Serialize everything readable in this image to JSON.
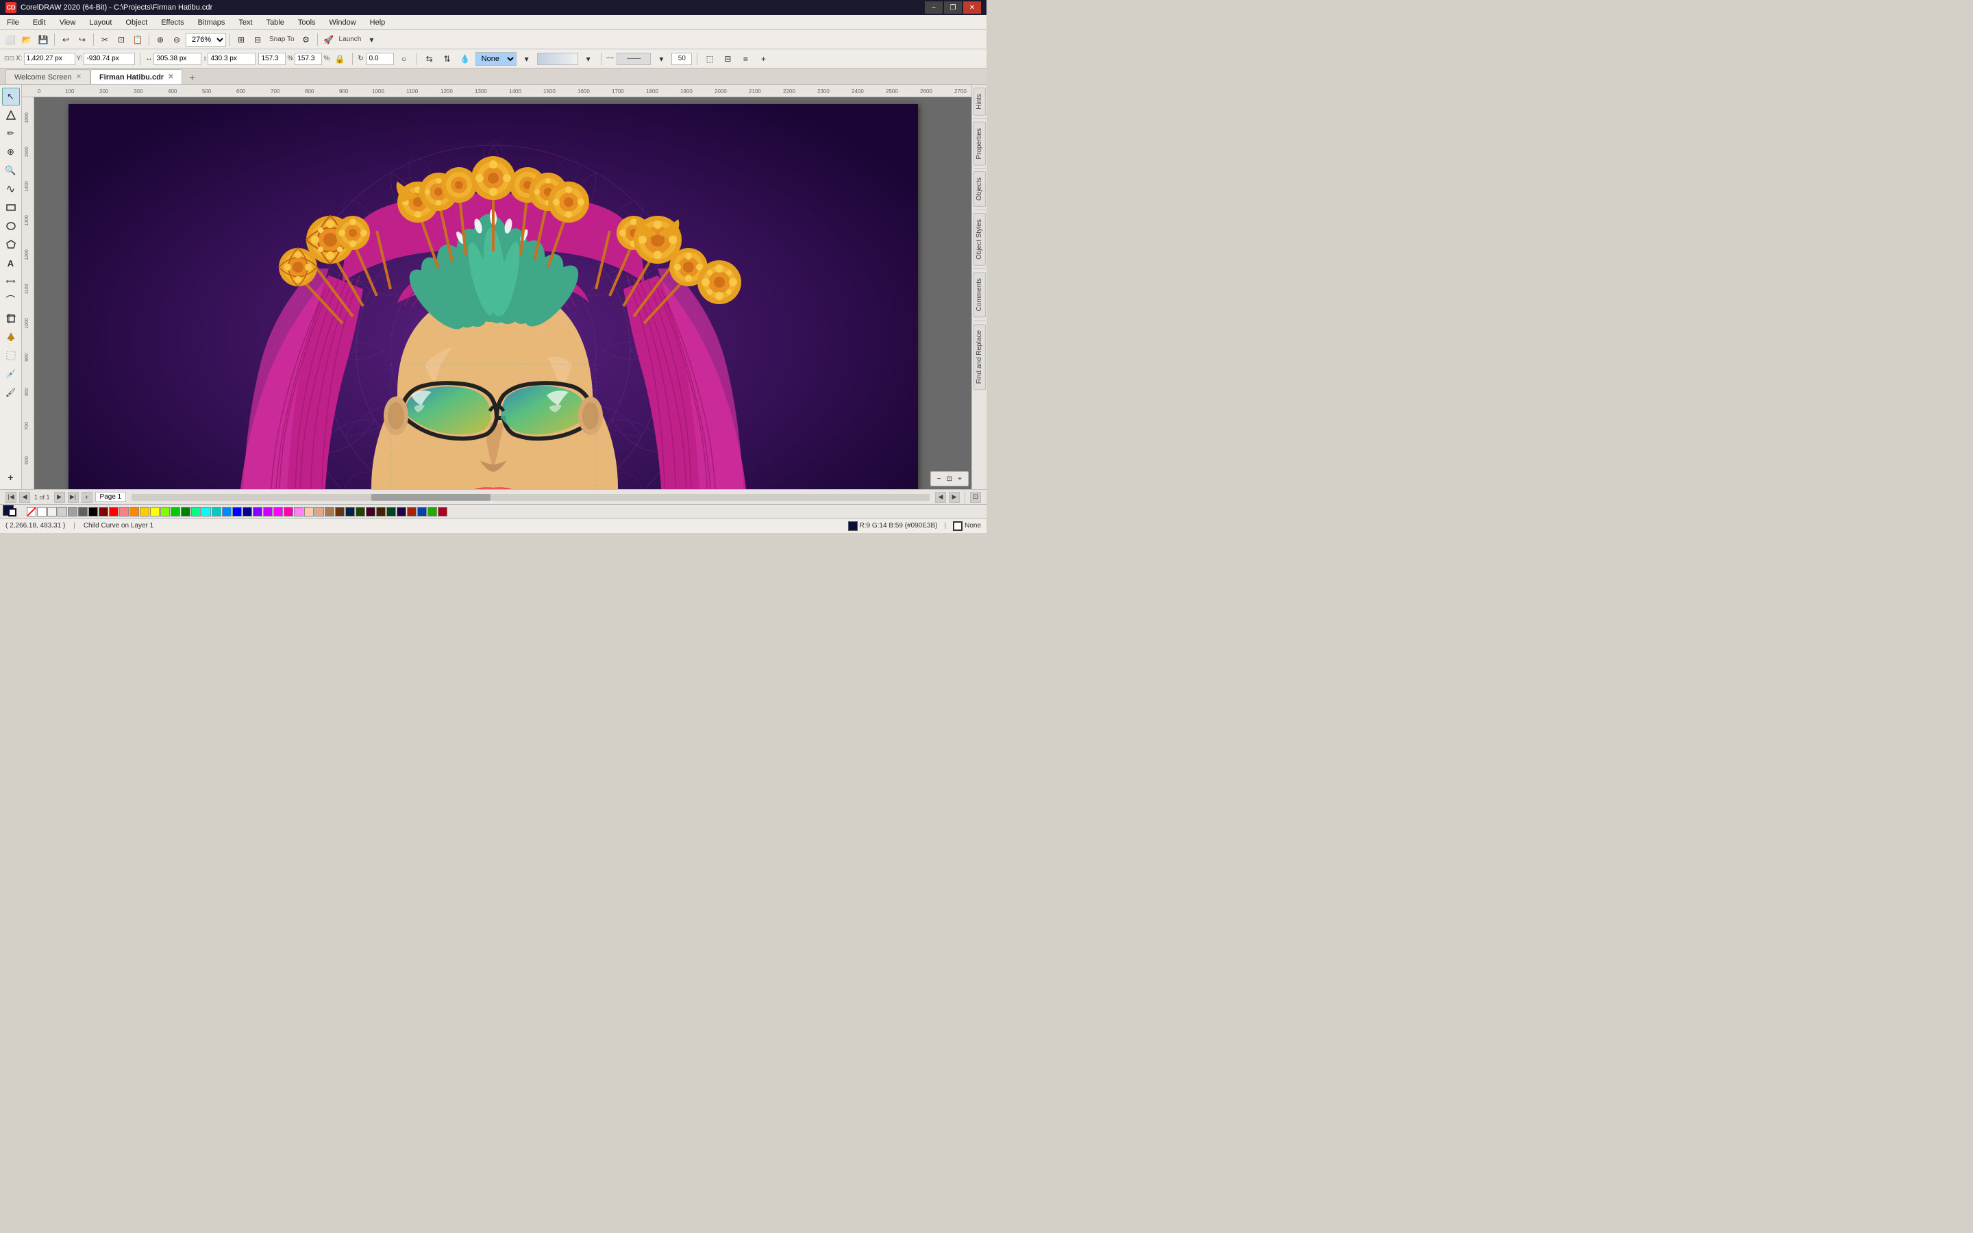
{
  "app": {
    "title": "CorelDRAW 2020 (64-Bit) - C:\\Projects\\Firman Hatibu.cdr",
    "icon_text": "CD",
    "version": "CorelDRAW 2020"
  },
  "titlebar": {
    "minimize_label": "−",
    "restore_label": "❐",
    "close_label": "✕"
  },
  "menubar": {
    "items": [
      {
        "label": "File"
      },
      {
        "label": "Edit"
      },
      {
        "label": "View"
      },
      {
        "label": "Layout"
      },
      {
        "label": "Object"
      },
      {
        "label": "Effects"
      },
      {
        "label": "Bitmaps"
      },
      {
        "label": "Text"
      },
      {
        "label": "Table"
      },
      {
        "label": "Tools"
      },
      {
        "label": "Window"
      },
      {
        "label": "Help"
      }
    ]
  },
  "toolbar1": {
    "zoom_level": "276%"
  },
  "propbar": {
    "x_label": "X:",
    "x_value": "1,420.27 px",
    "y_label": "Y:",
    "y_value": "-930.74 px",
    "w_label": "W:",
    "w_value": "305.38 px",
    "h_label": "H:",
    "h_value": "430.3 px",
    "scale_x": "157.3",
    "scale_y": "157.3",
    "scale_unit": "%",
    "rotation": "0.0",
    "fill_dropdown": "None",
    "opacity_value": "50"
  },
  "tabs": {
    "welcome_label": "Welcome Screen",
    "file_label": "Firman Hatibu.cdr",
    "add_label": "+"
  },
  "toolbox": {
    "tools": [
      {
        "name": "select-tool",
        "icon": "↖",
        "tooltip": "Pick Tool"
      },
      {
        "name": "node-tool",
        "icon": "⬡",
        "tooltip": "Node Tool"
      },
      {
        "name": "freehand-tool",
        "icon": "✏",
        "tooltip": "Freehand"
      },
      {
        "name": "transform-tool",
        "icon": "⊕",
        "tooltip": "Transform"
      },
      {
        "name": "zoom-tool",
        "icon": "🔍",
        "tooltip": "Zoom"
      },
      {
        "name": "curve-tool",
        "icon": "∿",
        "tooltip": "Curve"
      },
      {
        "name": "rectangle-tool",
        "icon": "▭",
        "tooltip": "Rectangle"
      },
      {
        "name": "ellipse-tool",
        "icon": "○",
        "tooltip": "Ellipse"
      },
      {
        "name": "polygon-tool",
        "icon": "⬠",
        "tooltip": "Polygon"
      },
      {
        "name": "text-tool",
        "icon": "A",
        "tooltip": "Text Tool"
      },
      {
        "name": "dimension-tool",
        "icon": "⟺",
        "tooltip": "Dimension"
      },
      {
        "name": "connector-tool",
        "icon": "⌒",
        "tooltip": "Connector"
      },
      {
        "name": "crop-tool",
        "icon": "⊡",
        "tooltip": "Crop"
      },
      {
        "name": "fill-tool",
        "icon": "◈",
        "tooltip": "Fill"
      },
      {
        "name": "transparency-tool",
        "icon": "◻",
        "tooltip": "Transparency"
      },
      {
        "name": "color-eyedropper",
        "icon": "💉",
        "tooltip": "Color Eyedropper"
      },
      {
        "name": "paint-tool",
        "icon": "🖌",
        "tooltip": "Paint"
      },
      {
        "name": "blend-tool",
        "icon": "+",
        "tooltip": "Interactive Blend"
      }
    ]
  },
  "right_panel": {
    "tabs": [
      {
        "name": "hints-tab",
        "label": "Hints"
      },
      {
        "name": "properties-tab",
        "label": "Properties"
      },
      {
        "name": "objects-tab",
        "label": "Objects"
      },
      {
        "name": "object-styles-tab",
        "label": "Object Styles"
      },
      {
        "name": "comments-tab",
        "label": "Comments"
      },
      {
        "name": "find-replace-tab",
        "label": "Find and Replace"
      }
    ]
  },
  "pagebar": {
    "page_info": "1 of 1",
    "page_name": "Page 1"
  },
  "statusbar": {
    "coordinates": "( 2,266.18, 483.31 )",
    "layer_info": "Child Curve on Layer 1",
    "fill_color": "#090E3B",
    "color_info": "R:9 G:14 B:59 (#090E3B)",
    "stroke_info": "None"
  },
  "canvas": {
    "background_color": "#4a1a7a",
    "artwork_description": "Woman with floral crown and sunglasses illustration"
  },
  "colors": {
    "accent_purple": "#4a1a7a",
    "hair_pink": "#e040a0",
    "crown_teal": "#40b8a0",
    "crown_gold": "#e8a020",
    "skin": "#e8c090",
    "bg_dark": "#2a0a4a"
  },
  "color_swatches": {
    "no_fill": "No Fill",
    "colors": [
      "#ffffff",
      "#000000",
      "#ff0000",
      "#00ff00",
      "#0000ff",
      "#ffff00",
      "#ff00ff",
      "#00ffff",
      "#ff8800",
      "#8800ff",
      "#0088ff",
      "#ff0088",
      "#88ff00",
      "#00ff88",
      "#884400",
      "#448800",
      "#004488",
      "#880044",
      "#cc4400",
      "#4400cc",
      "#44cc00",
      "#00cc44",
      "#0044cc",
      "#cc0044",
      "#ccaa00",
      "#aacc00",
      "#00aacc",
      "#cc00aa",
      "#aaccff",
      "#ffaacc",
      "#ccffaa",
      "#aaffcc",
      "#ffccaa",
      "#ccaaff",
      "#888888",
      "#444444",
      "#cccccc",
      "#ffccff",
      "#ccffff",
      "#ffffcc"
    ]
  }
}
